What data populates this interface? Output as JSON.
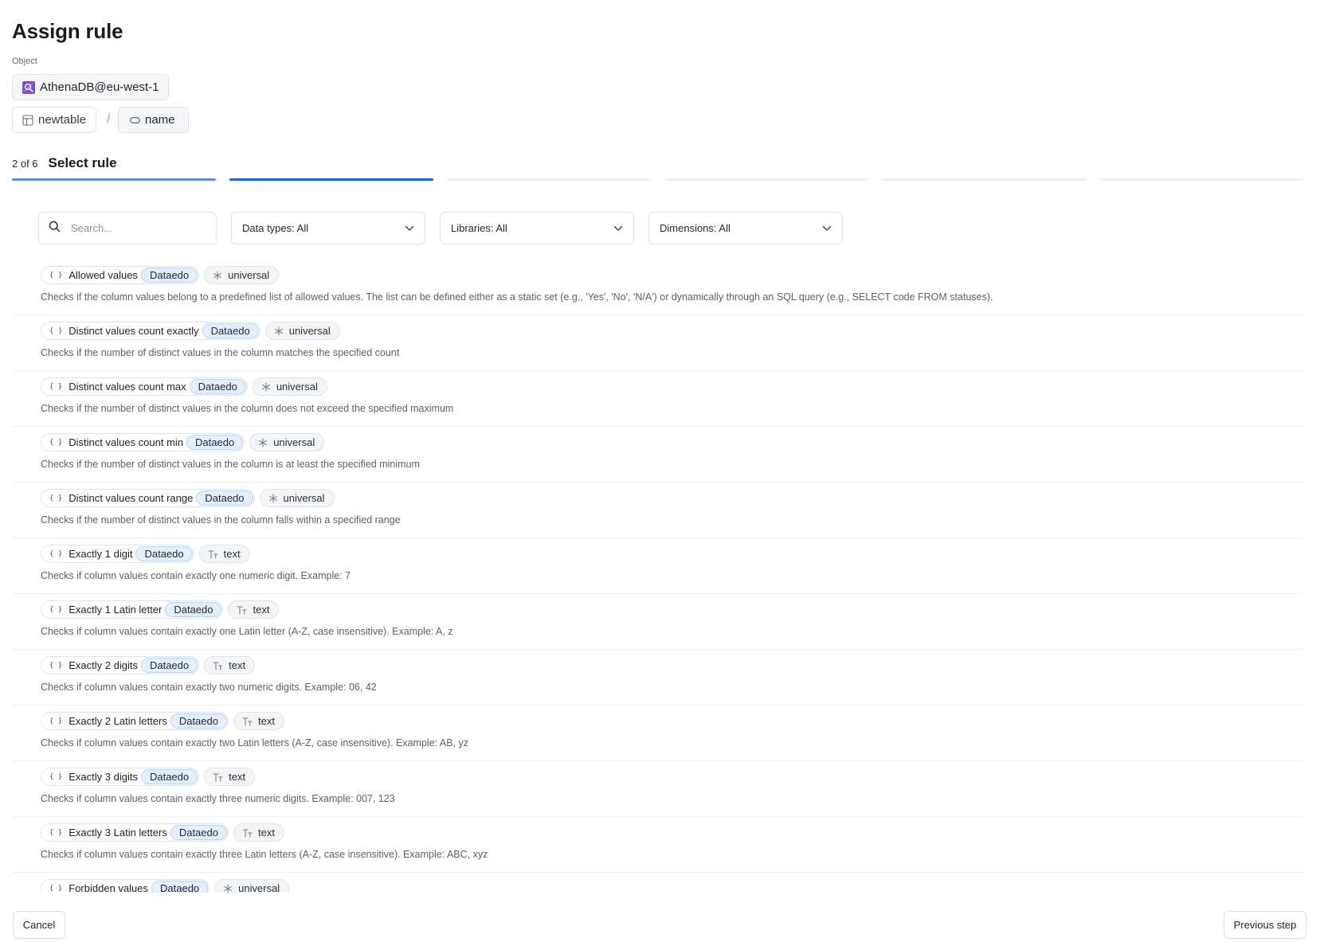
{
  "title": "Assign rule",
  "object_label": "Object",
  "object": {
    "name": "AthenaDB@eu-west-1",
    "icon": "database-icon"
  },
  "breadcrumb": {
    "table": "newtable",
    "separator": "/",
    "column": "name"
  },
  "step": {
    "count": "2 of 6",
    "title": "Select rule",
    "current": 2,
    "total": 6
  },
  "colors": {
    "progress_done": "#5a8ee3",
    "progress_active": "#1a66d6",
    "library_tag_bg": "#e5efff",
    "object_icon": "#7b4fd1"
  },
  "filters": {
    "search_placeholder": "Search...",
    "data_types": "Data types: All",
    "libraries": "Libraries: All",
    "dimensions": "Dimensions: All"
  },
  "rules": [
    {
      "name": "Allowed values",
      "library": "Dataedo",
      "type": "universal",
      "type_icon": "asterisk-icon",
      "description": "Checks if the column values belong to a predefined list of allowed values. The list can be defined either as a static set (e.g., 'Yes', 'No', 'N/A') or dynamically through an SQL query (e.g., SELECT code FROM statuses)."
    },
    {
      "name": "Distinct values count exactly",
      "library": "Dataedo",
      "type": "universal",
      "type_icon": "asterisk-icon",
      "description": "Checks if the number of distinct values in the column matches the specified count"
    },
    {
      "name": "Distinct values count max",
      "library": "Dataedo",
      "type": "universal",
      "type_icon": "asterisk-icon",
      "description": "Checks if the number of distinct values in the column does not exceed the specified maximum"
    },
    {
      "name": "Distinct values count min",
      "library": "Dataedo",
      "type": "universal",
      "type_icon": "asterisk-icon",
      "description": "Checks if the number of distinct values in the column is at least the specified minimum"
    },
    {
      "name": "Distinct values count range",
      "library": "Dataedo",
      "type": "universal",
      "type_icon": "asterisk-icon",
      "description": "Checks if the number of distinct values in the column falls within a specified range"
    },
    {
      "name": "Exactly 1 digit",
      "library": "Dataedo",
      "type": "text",
      "type_icon": "text-type-icon",
      "description": "Checks if column values contain exactly one numeric digit. Example: 7"
    },
    {
      "name": "Exactly 1 Latin letter",
      "library": "Dataedo",
      "type": "text",
      "type_icon": "text-type-icon",
      "description": "Checks if column values contain exactly one Latin letter (A-Z, case insensitive). Example: A, z"
    },
    {
      "name": "Exactly 2 digits",
      "library": "Dataedo",
      "type": "text",
      "type_icon": "text-type-icon",
      "description": "Checks if column values contain exactly two numeric digits. Example: 06, 42"
    },
    {
      "name": "Exactly 2 Latin letters",
      "library": "Dataedo",
      "type": "text",
      "type_icon": "text-type-icon",
      "description": "Checks if column values contain exactly two Latin letters (A-Z, case insensitive). Example: AB, yz"
    },
    {
      "name": "Exactly 3 digits",
      "library": "Dataedo",
      "type": "text",
      "type_icon": "text-type-icon",
      "description": "Checks if column values contain exactly three numeric digits. Example: 007, 123"
    },
    {
      "name": "Exactly 3 Latin letters",
      "library": "Dataedo",
      "type": "text",
      "type_icon": "text-type-icon",
      "description": "Checks if column values contain exactly three Latin letters (A-Z, case insensitive). Example: ABC, xyz"
    },
    {
      "name": "Forbidden values",
      "library": "Dataedo",
      "type": "universal",
      "type_icon": "asterisk-icon"
    }
  ],
  "rule_icon": "{ }",
  "footer": {
    "cancel": "Cancel",
    "previous": "Previous step"
  }
}
